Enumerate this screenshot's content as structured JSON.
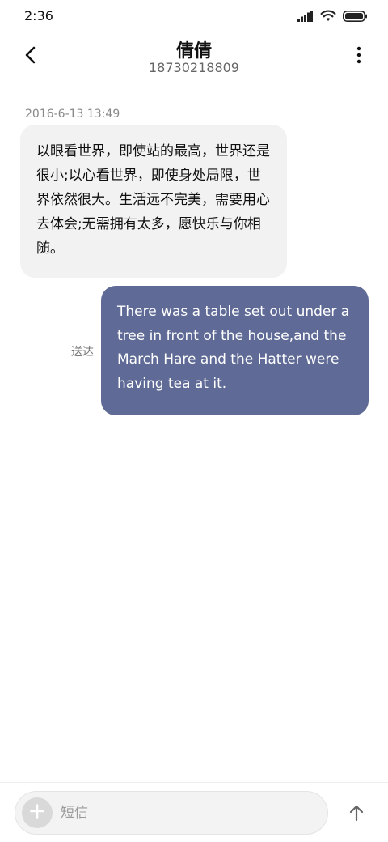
{
  "status_bar": {
    "time": "2:36",
    "icons": [
      "signal-icon",
      "wifi-icon",
      "battery-icon"
    ]
  },
  "header": {
    "contact_name": "倩倩",
    "contact_number": "18730218809",
    "back_icon": "chevron-left-icon",
    "more_icon": "more-vertical-icon"
  },
  "conversation": {
    "timestamp": "2016-6-13 13:49",
    "messages": [
      {
        "direction": "incoming",
        "text": "以眼看世界，即使站的最高，世界还是很小;以心看世界，即使身处局限，世界依然很大。生活远不完美，需要用心去体会;无需拥有太多，愿快乐与你相随。"
      },
      {
        "direction": "outgoing",
        "status": "送达",
        "text": "There was a table set out under a tree in front of the house,and the March Hare and the Hatter were having tea at it."
      }
    ]
  },
  "compose": {
    "placeholder": "短信",
    "value": "",
    "add_icon": "plus-icon",
    "send_icon": "arrow-up-icon"
  },
  "colors": {
    "incoming_bubble": "#f2f2f2",
    "outgoing_bubble": "#5f6b96",
    "background": "#ffffff"
  }
}
